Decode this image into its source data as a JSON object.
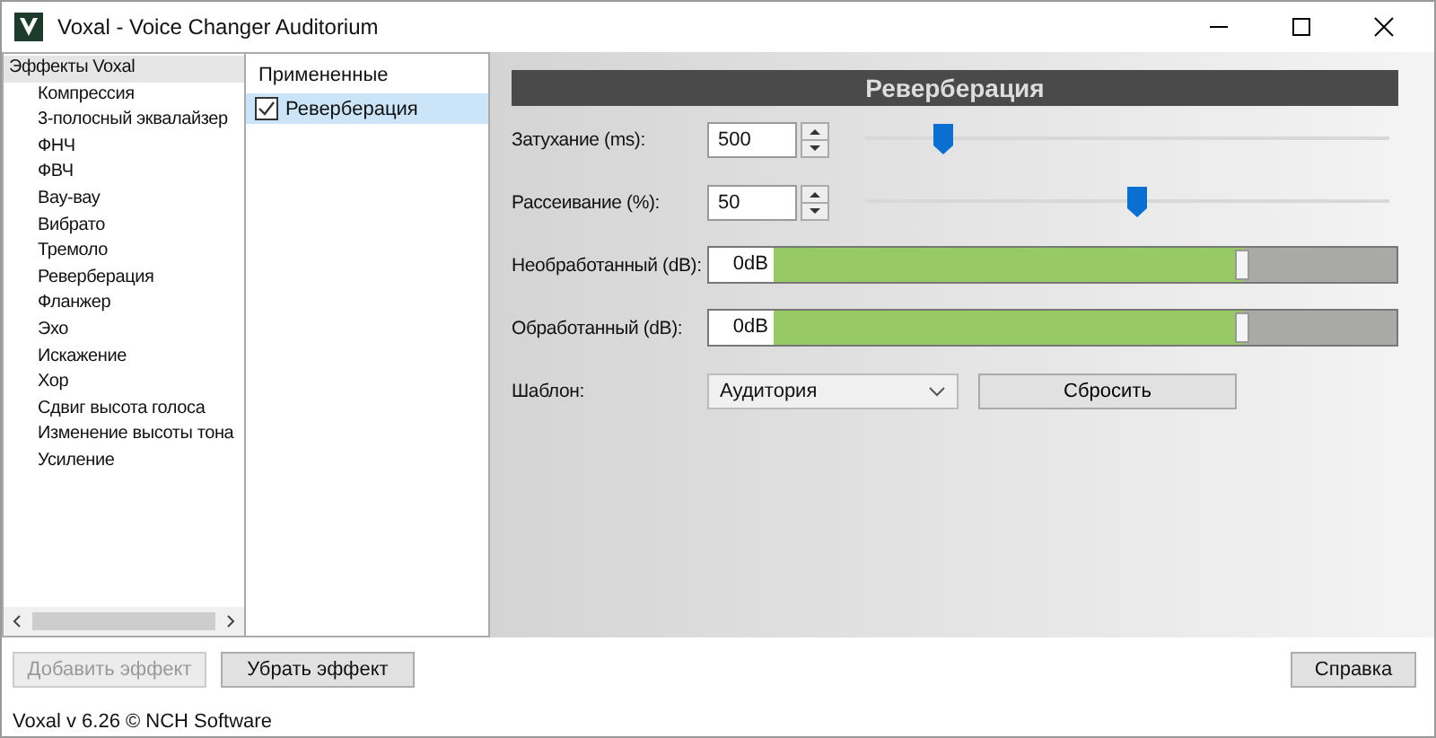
{
  "window": {
    "title": "Voxal - Voice Changer Auditorium"
  },
  "effects_tree": {
    "label": "Эффекты Voxal",
    "selected": true,
    "children": [
      {
        "label": "Компрессия"
      },
      {
        "label": "3-полосный эквалайзер"
      },
      {
        "label": "ФНЧ"
      },
      {
        "label": "ФВЧ"
      },
      {
        "label": "Вау-вау"
      },
      {
        "label": "Вибрато"
      },
      {
        "label": "Тремоло"
      },
      {
        "label": "Реверберация"
      },
      {
        "label": "Фланжер"
      },
      {
        "label": "Эхо"
      },
      {
        "label": "Искажение"
      },
      {
        "label": "Хор"
      },
      {
        "label": "Сдвиг высота голоса"
      },
      {
        "label": "Изменение высоты тона"
      },
      {
        "label": "Усиление"
      }
    ]
  },
  "applied": {
    "heading": "Примененные",
    "items": [
      {
        "label": "Реверберация",
        "checked": true,
        "selected": true
      }
    ]
  },
  "effect_panel": {
    "title": "Реверберация",
    "params": [
      {
        "kind": "slider",
        "label": "Затухание (ms):",
        "value": "500",
        "level": 0.13
      },
      {
        "kind": "slider",
        "label": "Рассеивание (%):",
        "value": "50",
        "level": 0.5
      },
      {
        "kind": "gain",
        "label": "Необработанный (dB):",
        "value": "0dB",
        "level": 0.755
      },
      {
        "kind": "gain",
        "label": "Обработанный (dB):",
        "value": "0dB",
        "level": 0.755
      }
    ],
    "preset": {
      "label": "Шаблон:",
      "value": "Аудитория"
    },
    "reset_button": "Сбросить"
  },
  "buttons": [
    {
      "label": "Добавить эффект",
      "disabled": true
    },
    {
      "label": "Убрать эффект",
      "disabled": false
    },
    {
      "label": "Справка",
      "disabled": false
    }
  ],
  "status_bar": "Voxal v 6.26 © NCH Software"
}
